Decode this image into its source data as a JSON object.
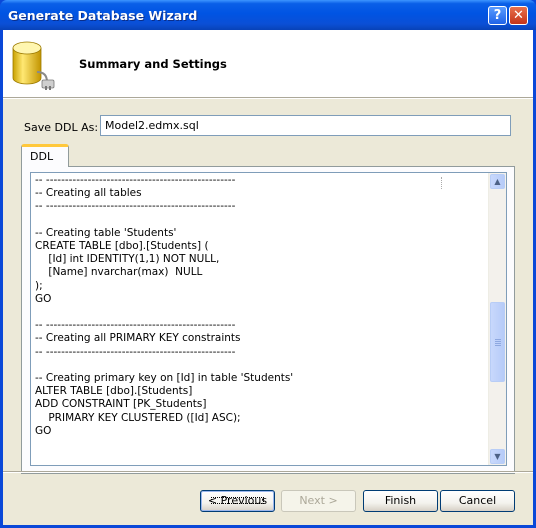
{
  "window": {
    "title": "Generate Database Wizard",
    "help_glyph": "?",
    "close_glyph": "✕"
  },
  "header": {
    "title": "Summary and Settings",
    "icon": "database-plug-icon"
  },
  "save_ddl": {
    "label": "Save DDL As:",
    "value": "Model2.edmx.sql"
  },
  "tabs": [
    {
      "label": "DDL",
      "active": true
    }
  ],
  "ddl_text": "-- --------------------------------------------------\n-- Creating all tables\n-- --------------------------------------------------\n\n-- Creating table 'Students'\nCREATE TABLE [dbo].[Students] (\n    [Id] int IDENTITY(1,1) NOT NULL,\n    [Name] nvarchar(max)  NULL\n);\nGO\n\n-- --------------------------------------------------\n-- Creating all PRIMARY KEY constraints\n-- --------------------------------------------------\n\n-- Creating primary key on [Id] in table 'Students'\nALTER TABLE [dbo].[Students]\nADD CONSTRAINT [PK_Students]\n    PRIMARY KEY CLUSTERED ([Id] ASC);\nGO",
  "scrollbar": {
    "up_glyph": "▲",
    "down_glyph": "▼"
  },
  "buttons": {
    "previous": "< Previous",
    "next": "Next >",
    "finish": "Finish",
    "cancel": "Cancel"
  },
  "colors": {
    "titlebar": "#0054e3",
    "dialog_bg": "#ece9d8",
    "tab_highlight": "#ffc83c"
  }
}
